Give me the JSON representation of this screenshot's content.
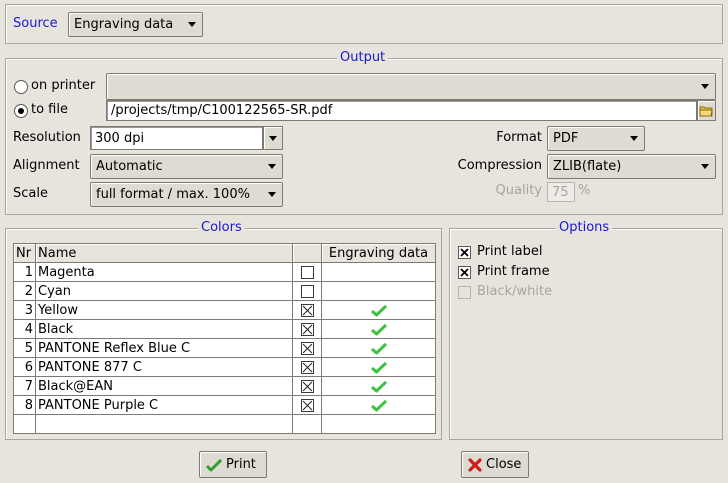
{
  "source": {
    "label": "Source",
    "value": "Engraving data"
  },
  "output": {
    "title": "Output",
    "on_printer_label": "on printer",
    "printer_value": "",
    "to_file_label": "to file",
    "file_path": "/projects/tmp/C100122565-SR.pdf",
    "resolution_label": "Resolution",
    "resolution_value": "300 dpi",
    "alignment_label": "Alignment",
    "alignment_value": "Automatic",
    "scale_label": "Scale",
    "scale_value": "full format / max. 100%",
    "format_label": "Format",
    "format_value": "PDF",
    "compression_label": "Compression",
    "compression_value": "ZLIB(flate)",
    "quality_label": "Quality",
    "quality_value": "75",
    "quality_unit": "%"
  },
  "colors": {
    "title": "Colors",
    "headers": {
      "nr": "Nr",
      "name": "Name",
      "check": "",
      "engraving": "Engraving data"
    },
    "rows": [
      {
        "nr": "1",
        "name": "Magenta",
        "checked": false,
        "engraving": false
      },
      {
        "nr": "2",
        "name": "Cyan",
        "checked": false,
        "engraving": false
      },
      {
        "nr": "3",
        "name": "Yellow",
        "checked": true,
        "engraving": true
      },
      {
        "nr": "4",
        "name": "Black",
        "checked": true,
        "engraving": true
      },
      {
        "nr": "5",
        "name": "PANTONE Reflex Blue C",
        "checked": true,
        "engraving": true
      },
      {
        "nr": "6",
        "name": "PANTONE 877 C",
        "checked": true,
        "engraving": true
      },
      {
        "nr": "7",
        "name": "Black@EAN",
        "checked": true,
        "engraving": true
      },
      {
        "nr": "8",
        "name": "PANTONE Purple C",
        "checked": true,
        "engraving": true
      }
    ]
  },
  "options": {
    "title": "Options",
    "print_label": "Print label",
    "print_frame": "Print frame",
    "black_white": "Black/white"
  },
  "buttons": {
    "print": "Print",
    "close": "Close"
  },
  "colors_accent": {
    "legend": "#1a1acc",
    "tick": "#3cc23c",
    "close_x": "#d21a1a"
  }
}
